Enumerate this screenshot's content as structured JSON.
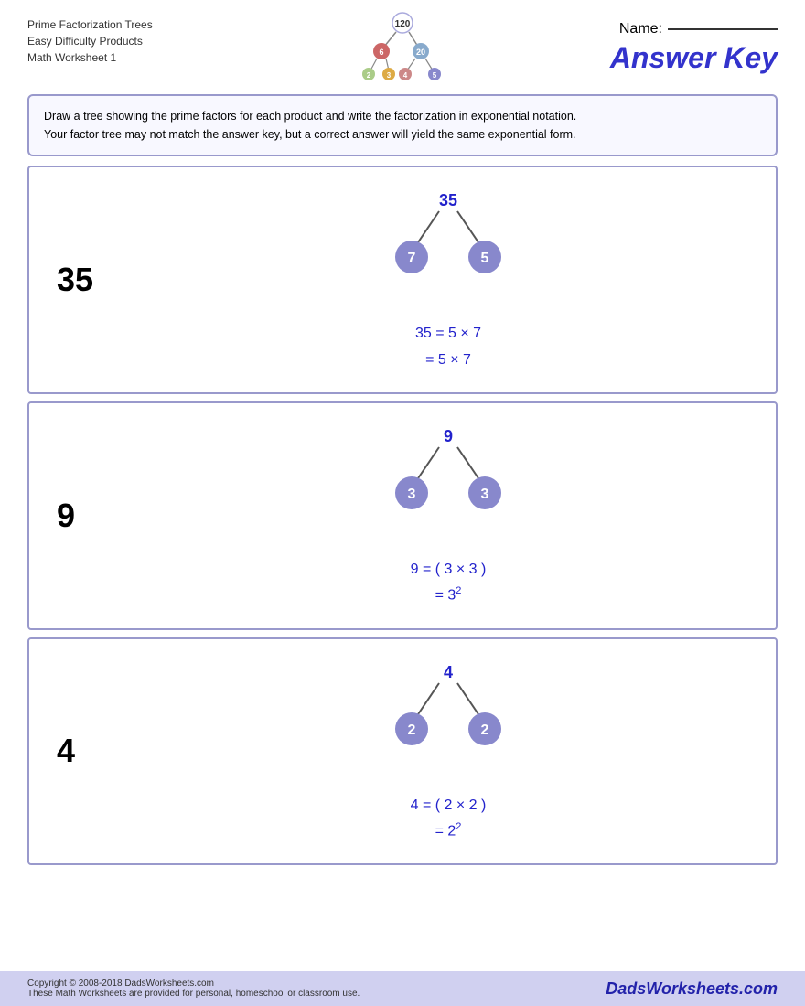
{
  "header": {
    "line1": "Prime Factorization Trees",
    "line2": "Easy Difficulty Products",
    "line3": "Math Worksheet 1",
    "name_label": "Name:",
    "answer_key": "Answer Key"
  },
  "instructions": {
    "line1": "Draw a tree showing the prime factors for each product and write the factorization in exponential notation.",
    "line2": "Your factor tree may not match the answer key, but a correct answer will yield the same exponential form."
  },
  "problems": [
    {
      "number": "35",
      "root": "35",
      "left_child": "7",
      "right_child": "5",
      "line1": "35 = 5 × 7",
      "line2": "= 5 × 7"
    },
    {
      "number": "9",
      "root": "9",
      "left_child": "3",
      "right_child": "3",
      "line1": "9 = ( 3 × 3 )",
      "line2_base": "= 3",
      "line2_exp": "2"
    },
    {
      "number": "4",
      "root": "4",
      "left_child": "2",
      "right_child": "2",
      "line1": "4 = ( 2 × 2 )",
      "line2_base": "= 2",
      "line2_exp": "2"
    }
  ],
  "footer": {
    "copyright": "Copyright © 2008-2018 DadsWorksheets.com",
    "note": "These Math Worksheets are provided for personal, homeschool or classroom use.",
    "brand": "DadsWorksheets.com"
  }
}
